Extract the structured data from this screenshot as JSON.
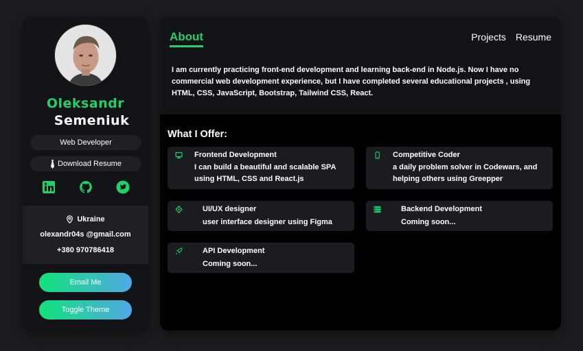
{
  "profile": {
    "first_name": "Oleksandr",
    "last_name": "Semeniuk",
    "role": "Web Developer",
    "download_label": "Download Resume",
    "socials": [
      "linkedin-icon",
      "github-icon",
      "twitter-icon"
    ],
    "location": "Ukraine",
    "email": "olexandr04s @gmail.com",
    "phone": "+380 970786418",
    "email_button": "Email Me",
    "theme_button": "Toggle Theme"
  },
  "main": {
    "title": "About",
    "nav": [
      "Projects",
      "Resume"
    ],
    "about_text": "I am currently practicing front-end development and learning back-end in Node.js. Now I have no commercial web development experience, but I have completed several educational projects , using HTML, CSS, JavaScript, Bootstrap, Tailwind CSS, React.",
    "offer_title": "What I Offer:",
    "offers": [
      {
        "icon": "monitor-icon",
        "title": "Frontend Development",
        "desc": "I can build a beautiful and scalable SPA using HTML, CSS and React.js"
      },
      {
        "icon": "phone-icon",
        "title": "Competitive Coder",
        "desc": "a daily problem solver in Codewars, and helping others using Greepper"
      },
      {
        "icon": "pen-tool-icon",
        "title": "UI/UX designer",
        "desc": "user interface designer using Figma"
      },
      {
        "icon": "server-icon",
        "title": "Backend Development",
        "desc": "Coming soon..."
      },
      {
        "icon": "rocket-icon",
        "title": "API Development",
        "desc": "Coming soon..."
      }
    ]
  },
  "colors": {
    "accent": "#1fd16a",
    "gradient_start": "#10e37a",
    "gradient_end": "#52a8e6",
    "panel": "#121316",
    "card": "#1b1c21",
    "background": "#1b1c1f"
  }
}
